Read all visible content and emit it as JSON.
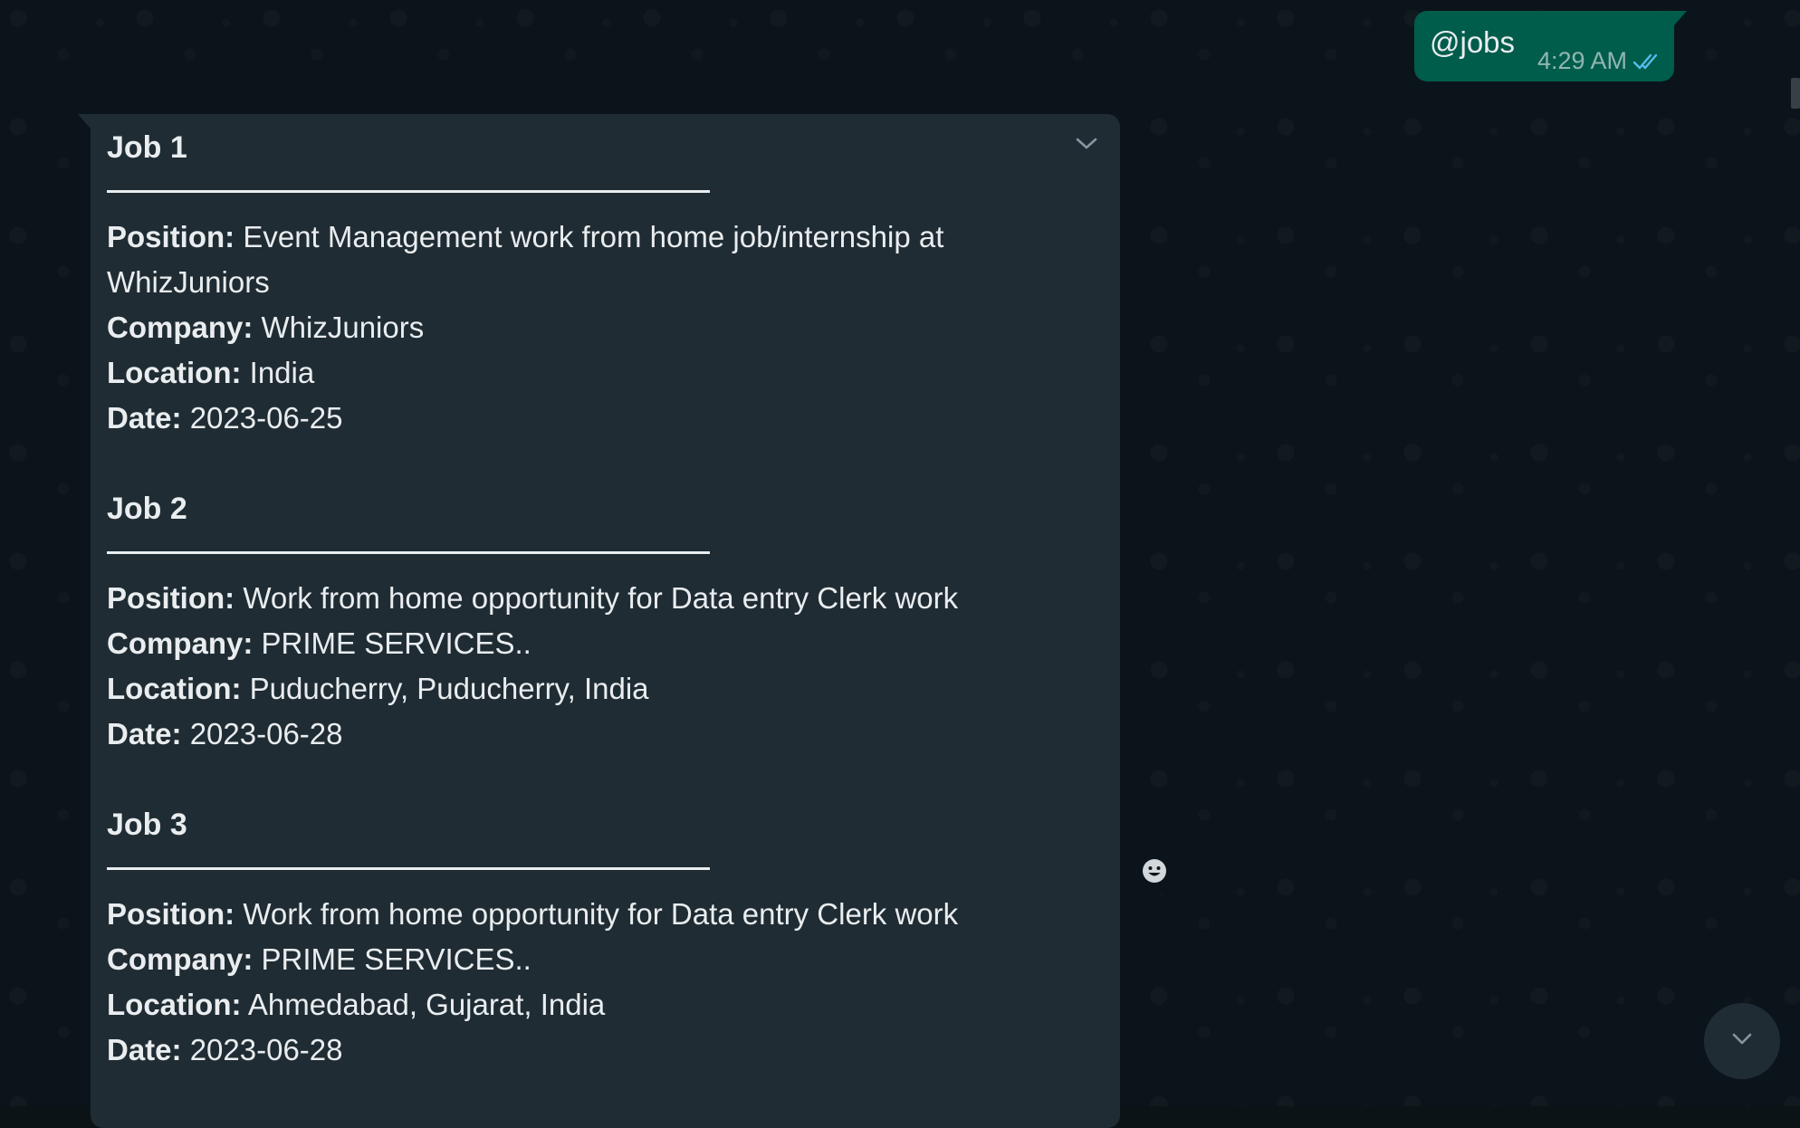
{
  "outgoing_message": {
    "text": "@jobs",
    "time": "4:29 AM",
    "status_icon": "double-check-read-icon"
  },
  "incoming_message": {
    "menu_icon": "chevron-down-icon",
    "jobs": [
      {
        "title": "Job 1",
        "position_label": "Position:",
        "position_value": "Event Management work from home job/internship at WhizJuniors",
        "company_label": "Company:",
        "company_value": "WhizJuniors",
        "location_label": "Location:",
        "location_value": "India",
        "date_label": "Date:",
        "date_value": "2023-06-25"
      },
      {
        "title": "Job 2",
        "position_label": "Position:",
        "position_value": "Work from home opportunity for Data entry Clerk work",
        "company_label": "Company:",
        "company_value": "PRIME SERVICES..",
        "location_label": "Location:",
        "location_value": "Puducherry, Puducherry, India",
        "date_label": "Date:",
        "date_value": "2023-06-28"
      },
      {
        "title": "Job 3",
        "position_label": "Position:",
        "position_value": "Work from home opportunity for Data entry Clerk work",
        "company_label": "Company:",
        "company_value": "PRIME SERVICES..",
        "location_label": "Location:",
        "location_value": "Ahmedabad, Gujarat, India",
        "date_label": "Date:",
        "date_value": "2023-06-28"
      }
    ]
  },
  "reaction_button_icon": "smiley-icon",
  "scroll_down_icon": "chevron-down-icon",
  "colors": {
    "background": "#0b141a",
    "incoming_bubble": "#202c33",
    "outgoing_bubble": "#005c4b",
    "read_tick": "#53bdeb",
    "text": "#e9edef"
  }
}
